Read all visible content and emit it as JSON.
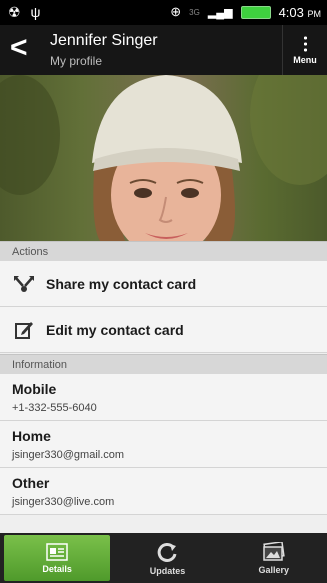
{
  "status_bar": {
    "time": "4:03",
    "ampm": "PM",
    "network": "3G"
  },
  "header": {
    "title": "Jennifer Singer",
    "subtitle": "My profile",
    "menu_label": "Menu"
  },
  "sections": {
    "actions": {
      "header": "Actions",
      "items": [
        {
          "label": "Share my contact card",
          "icon": "share-icon"
        },
        {
          "label": "Edit my contact card",
          "icon": "edit-icon"
        }
      ]
    },
    "information": {
      "header": "Information",
      "items": [
        {
          "type": "Mobile",
          "value": "+1-332-555-6040"
        },
        {
          "type": "Home",
          "value": "jsinger330@gmail.com"
        },
        {
          "type": "Other",
          "value": "jsinger330@live.com"
        }
      ]
    }
  },
  "bottom_tabs": [
    {
      "label": "Details",
      "icon": "details-icon",
      "active": true
    },
    {
      "label": "Updates",
      "icon": "sync-icon",
      "active": false
    },
    {
      "label": "Gallery",
      "icon": "gallery-icon",
      "active": false
    }
  ]
}
